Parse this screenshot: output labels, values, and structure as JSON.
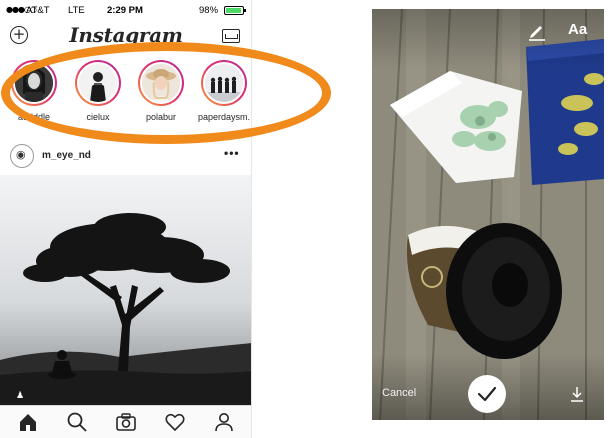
{
  "status_bar": {
    "signal": "●●●○○",
    "carrier": "AT&T",
    "network": "LTE",
    "time": "2:29 PM",
    "battery": "98%"
  },
  "header": {
    "logo": "Instagram",
    "new_story_icon": "plus-circle-icon",
    "inbox_icon": "inbox-icon"
  },
  "stories": [
    {
      "username": "audddle"
    },
    {
      "username": "cielux"
    },
    {
      "username": "polabur"
    },
    {
      "username": "paperdaysm."
    }
  ],
  "annotation": {
    "color": "#f08a1a"
  },
  "post": {
    "username": "m_eye_nd",
    "more": "•••"
  },
  "tab_bar": {
    "items": [
      "home-icon",
      "search-icon",
      "camera-icon",
      "heart-icon",
      "profile-icon"
    ]
  },
  "story_editor": {
    "text_tool": "Aa",
    "cancel": "Cancel",
    "draw_icon": "pencil-icon",
    "confirm_icon": "checkmark-icon",
    "save_icon": "download-icon"
  },
  "colors": {
    "story_ring_start": "#f9a23b",
    "story_ring_mid": "#e1306c",
    "story_ring_end": "#b22b9c",
    "battery_green": "#4cd964"
  }
}
